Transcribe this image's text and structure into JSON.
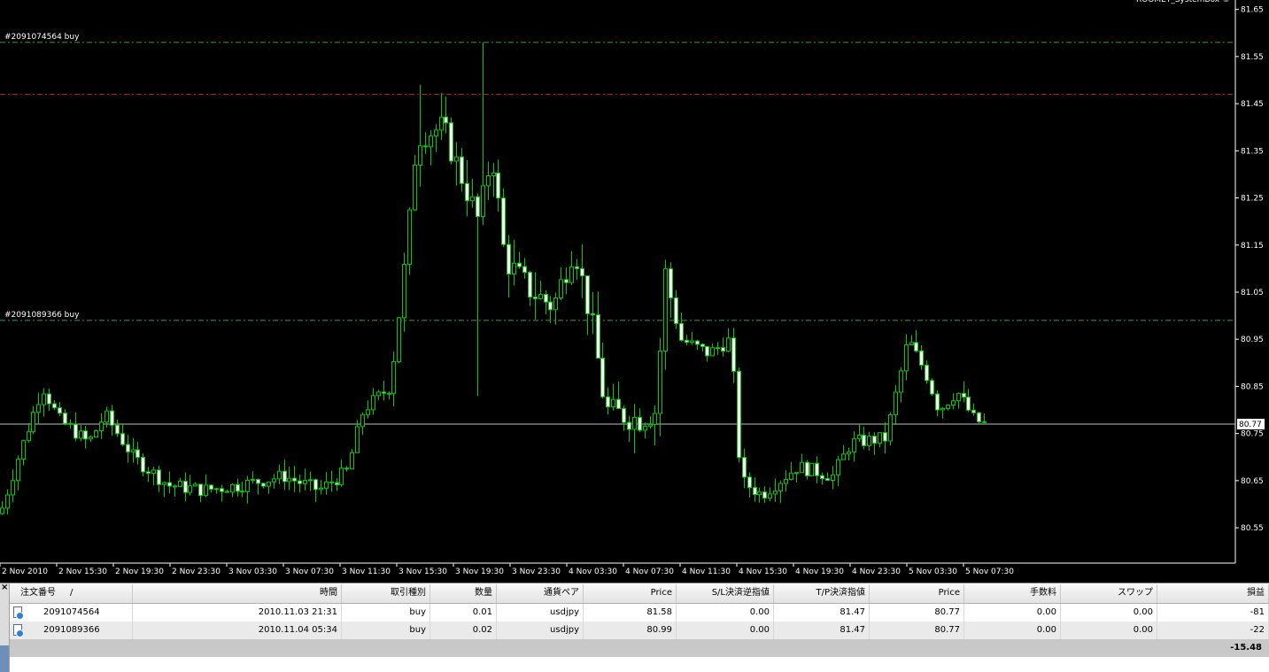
{
  "chart": {
    "watermark": "ROOMEY_SystemBox ©",
    "price_labels": [
      "81.65",
      "81.55",
      "81.45",
      "81.35",
      "81.25",
      "81.15",
      "81.05",
      "80.95",
      "80.85",
      "80.75",
      "80.65",
      "80.55"
    ],
    "current_price": "80.77",
    "time_labels": [
      "2 Nov 2010",
      "2 Nov 15:30",
      "2 Nov 19:30",
      "2 Nov 23:30",
      "3 Nov 03:30",
      "3 Nov 07:30",
      "3 Nov 11:30",
      "3 Nov 15:30",
      "3 Nov 19:30",
      "3 Nov 23:30",
      "4 Nov 03:30",
      "4 Nov 07:30",
      "4 Nov 11:30",
      "4 Nov 15:30",
      "4 Nov 19:30",
      "4 Nov 23:30",
      "5 Nov 03:30",
      "5 Nov 07:30"
    ],
    "order_lines": [
      {
        "label": "#2091074564 buy",
        "price": 81.58,
        "color": "#3aa03a"
      },
      {
        "label": "#2091089366 buy",
        "price": 80.99,
        "color": "#3aa03a"
      }
    ],
    "tp_line": {
      "price": 81.47,
      "color": "#c01818"
    },
    "colors": {
      "bull": "#000000",
      "bear": "#ffffff",
      "wick": "#00cc00",
      "axis": "#ffffff"
    },
    "price_range": [
      80.475,
      81.67
    ]
  },
  "terminal": {
    "close": "×",
    "headers": {
      "order": "注文番号",
      "sort": "/",
      "time": "時間",
      "type": "取引種別",
      "lots": "数量",
      "pair": "通貨ペア",
      "price": "Price",
      "sl": "S/L決済逆指値",
      "tp": "T/P決済指値",
      "cur_price": "Price",
      "commission": "手数料",
      "swap": "スワップ",
      "profit": "損益"
    },
    "rows": [
      {
        "order": "2091074564",
        "time": "2010.11.03 21:31",
        "type": "buy",
        "lots": "0.01",
        "pair": "usdjpy",
        "price": "81.58",
        "sl": "0.00",
        "tp": "81.47",
        "cur_price": "80.77",
        "commission": "0.00",
        "swap": "0.00",
        "profit": "-81"
      },
      {
        "order": "2091089366",
        "time": "2010.11.04 05:34",
        "type": "buy",
        "lots": "0.02",
        "pair": "usdjpy",
        "price": "80.99",
        "sl": "0.00",
        "tp": "81.47",
        "cur_price": "80.77",
        "commission": "0.00",
        "swap": "0.00",
        "profit": "-22"
      }
    ],
    "total_profit": "-15.48"
  }
}
